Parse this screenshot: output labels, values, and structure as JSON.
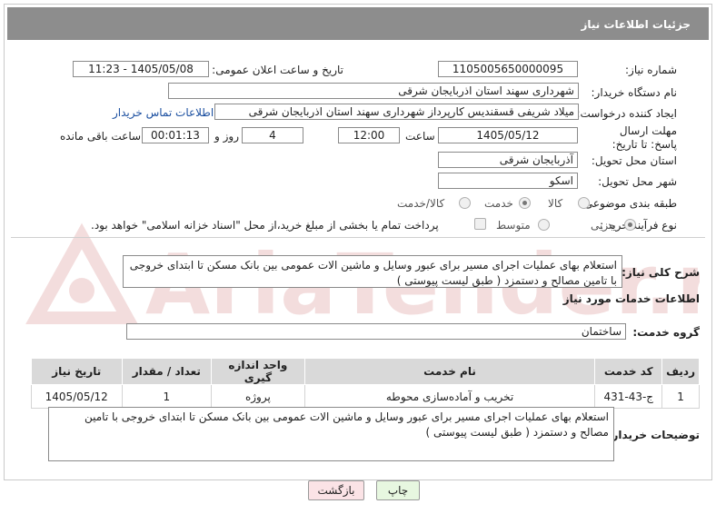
{
  "header": {
    "title": "جزئیات اطلاعات نیاز"
  },
  "form": {
    "need_number_label": "شماره نیاز:",
    "need_number": "1105005650000095",
    "announce_label": "تاریخ و ساعت اعلان عمومی:",
    "announce_value": "1405/05/08 - 11:23",
    "buyer_org_label": "نام دستگاه خریدار:",
    "buyer_org": "شهرداری سهند استان اذربایجان شرقی",
    "creator_label": "ایجاد کننده درخواست:",
    "creator": "میلاد شریفی قسقندیس کارپرداز  شهرداری سهند استان اذربایجان شرقی",
    "contact_link": "اطلاعات تماس خریدار",
    "deadline_label": "مهلت ارسال پاسخ: تا تاریخ:",
    "deadline_date": "1405/05/12",
    "time_label": "ساعت",
    "deadline_time": "12:00",
    "days_value": "4",
    "days_label": "روز و",
    "remaining_value": "00:01:13",
    "remaining_label": "ساعت باقی مانده",
    "province_label": "استان محل تحویل:",
    "province": "آذربایجان شرقی",
    "city_label": "شهر محل تحویل:",
    "city": "اسکو",
    "category_label": "طبقه بندی موضوعی:",
    "category_options": [
      {
        "label": "کالا",
        "selected": false
      },
      {
        "label": "خدمت",
        "selected": true
      },
      {
        "label": "کالا/خدمت",
        "selected": false
      }
    ],
    "process_label": "نوع فرآیند خرید :",
    "process_options": [
      {
        "label": "جزیی",
        "selected": true
      },
      {
        "label": "متوسط",
        "selected": false
      }
    ],
    "payment_note": "پرداخت تمام یا بخشی از مبلغ خرید،از محل \"اسناد خزانه اسلامی\" خواهد بود."
  },
  "summary": {
    "label": "شرح کلی نیاز:",
    "text": "استعلام بهای عملیات اجرای مسیر برای عبور وسایل و ماشین الات عمومی بین بانک مسکن تا ابتدای خروجی با تامین مصالح و دستمزد ( طبق لیست پیوستی )"
  },
  "services": {
    "section_title": "اطلاعات خدمات مورد نیاز",
    "group_label": "گروه خدمت:",
    "group_value": "ساختمان",
    "columns": [
      "ردیف",
      "کد خدمت",
      "نام خدمت",
      "واحد اندازه گیری",
      "تعداد / مقدار",
      "تاریخ نیاز"
    ],
    "rows": [
      [
        "1",
        "ج-43-431",
        "تخریب و آماده‌سازی محوطه",
        "پروژه",
        "1",
        "1405/05/12"
      ]
    ]
  },
  "buyer_notes": {
    "label": "توضیحات خریدار:",
    "text": "استعلام بهای عملیات اجرای مسیر برای عبور وسایل و ماشین الات عمومی بین بانک مسکن تا ابتدای خروجی با تامین مصالح و دستمزد ( طبق لیست پیوستی )"
  },
  "buttons": {
    "print": "چاپ",
    "back": "بازگشت"
  },
  "watermark": {
    "text": "AriaTender.net"
  },
  "colors": {
    "header_bg": "#8d8d8d",
    "link": "#1b4fa0",
    "print_bg": "#e7f7e0",
    "back_bg": "#fbe3e6"
  }
}
